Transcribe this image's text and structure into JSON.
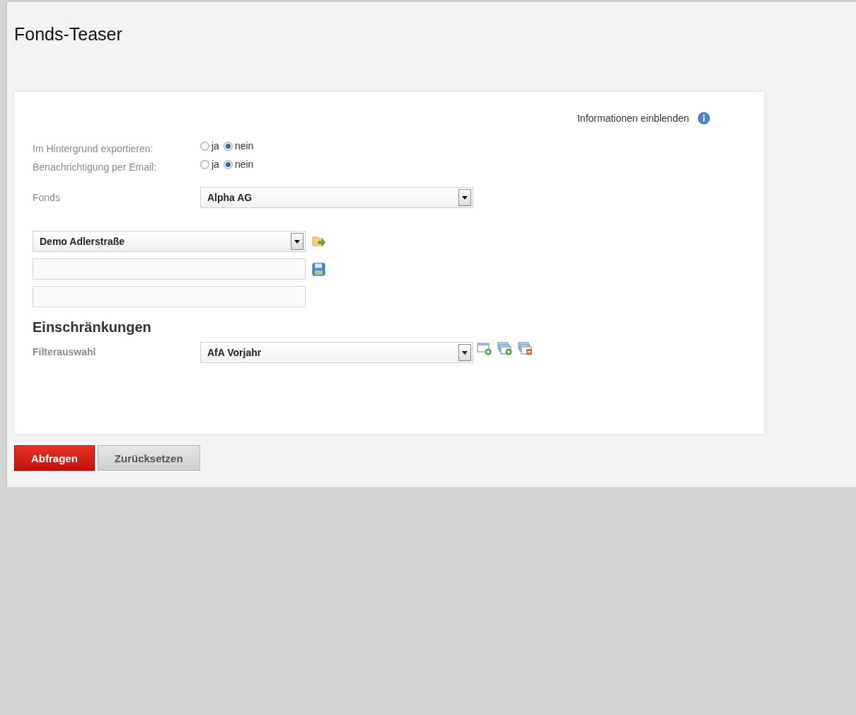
{
  "title": "Fonds-Teaser",
  "info_link": "Informationen einblenden",
  "options": [
    {
      "label": "Im Hintergrund exportieren:",
      "choices": [
        {
          "label": "ja",
          "selected": false
        },
        {
          "label": "nein",
          "selected": true
        }
      ]
    },
    {
      "label": "Benachrichtigung per Email:",
      "choices": [
        {
          "label": "ja",
          "selected": false
        },
        {
          "label": "nein",
          "selected": true
        }
      ]
    }
  ],
  "fonds": {
    "label": "Fonds",
    "value": "Alpha AG"
  },
  "template": {
    "value": "Demo Adlerstraße"
  },
  "section_title": "Einschränkungen",
  "filter": {
    "label": "Filterauswahl",
    "value": "AfA Vorjahr"
  },
  "buttons": [
    {
      "label": "Abfragen",
      "kind": "primary"
    },
    {
      "label": "Zurücksetzen",
      "kind": "secondary"
    }
  ]
}
